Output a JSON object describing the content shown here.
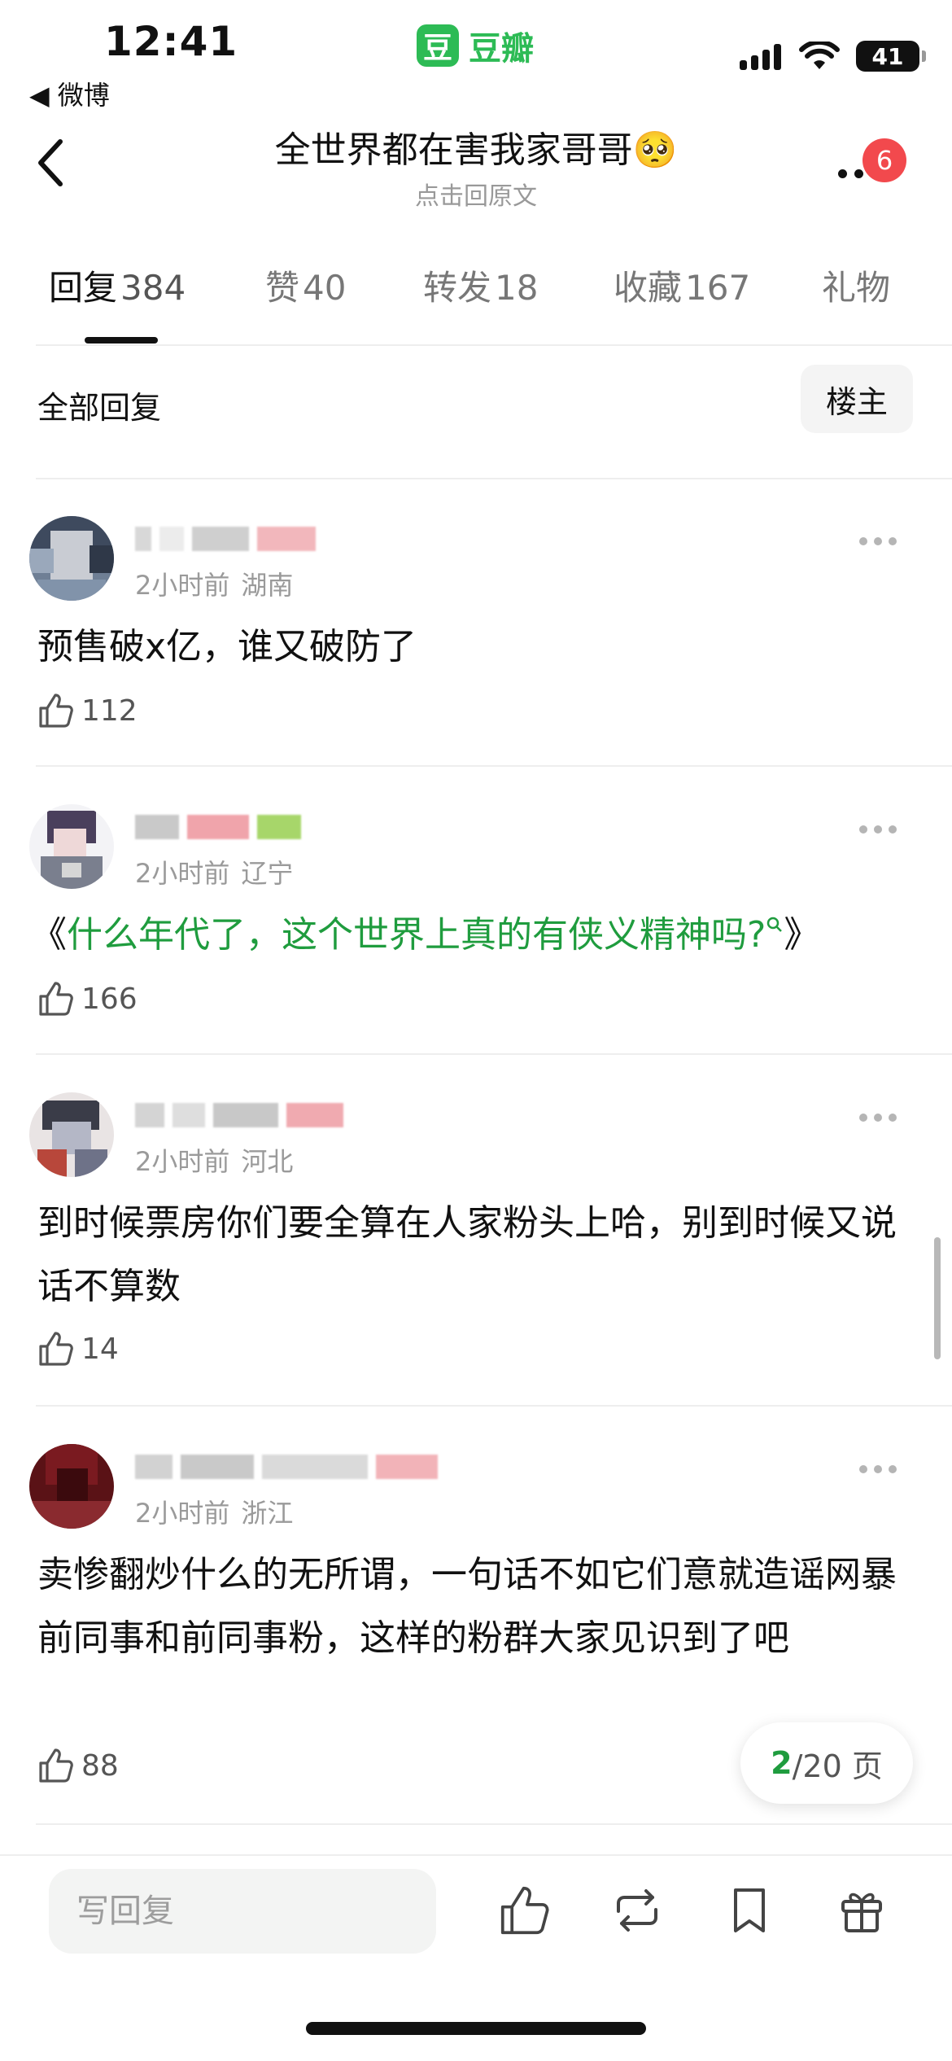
{
  "status_bar": {
    "time": "12:41",
    "back_app": "◀ 微博",
    "app_logo_char": "豆",
    "app_name": "豆瓣",
    "battery": "41"
  },
  "header": {
    "title": "全世界都在害我家哥哥🥺",
    "subtitle": "点击回原文",
    "notification_count": "6"
  },
  "tabs": [
    {
      "label": "回复",
      "count": "384",
      "active": true
    },
    {
      "label": "赞",
      "count": "40",
      "active": false
    },
    {
      "label": "转发",
      "count": "18",
      "active": false
    },
    {
      "label": "收藏",
      "count": "167",
      "active": false
    },
    {
      "label": "礼物",
      "count": "",
      "active": false
    }
  ],
  "filter": {
    "label": "全部回复",
    "op_button": "楼主"
  },
  "comments": [
    {
      "time": "2小时前",
      "location": "湖南",
      "text": "预售破x亿，谁又破防了",
      "likes": "112"
    },
    {
      "time": "2小时前",
      "location": "辽宁",
      "text_open": "《",
      "text_link": "什么年代了，这个世界上真的有侠义精神吗?",
      "text_close": "》",
      "likes": "166"
    },
    {
      "time": "2小时前",
      "location": "河北",
      "text": "到时候票房你们要全算在人家粉头上哈，别到时候又说话不算数",
      "likes": "14"
    },
    {
      "time": "2小时前",
      "location": "浙江",
      "text": "卖惨翻炒什么的无所谓，一句话不如它们意就造谣网暴前同事和前同事粉，这样的粉群大家见识到了吧",
      "likes": "88"
    }
  ],
  "pagination": {
    "current": "2",
    "total_text": "/20 页"
  },
  "bottom_bar": {
    "reply_placeholder": "写回复"
  },
  "colors": {
    "brand_green": "#2dbb55",
    "link_green": "#1f9c3e",
    "badge_red": "#f2494d"
  },
  "icons": [
    "back-chevron-icon",
    "more-dots-icon",
    "thumb-up-icon",
    "repost-icon",
    "bookmark-icon",
    "gift-icon",
    "wifi-icon",
    "signal-icon",
    "battery-icon"
  ]
}
